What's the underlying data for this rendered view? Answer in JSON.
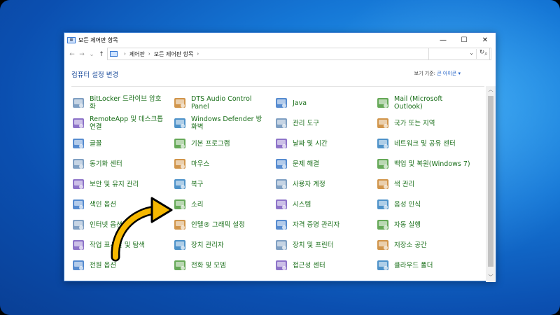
{
  "window": {
    "title": "모든 제어판 항목"
  },
  "address": {
    "crumbs": [
      "제어판",
      "모든 제어판 항목"
    ]
  },
  "header": {
    "title": "컴퓨터 설정 변경",
    "viewby_label": "보기 기준:",
    "viewby_value": "큰 아이콘"
  },
  "colors": {
    "link": "#1a6f1a",
    "heading": "#1e4e9c",
    "desktop": "#1577d6"
  },
  "items": [
    [
      "BitLocker 드라이브 암호화",
      "DTS Audio Control Panel",
      "Java",
      "Mail (Microsoft Outlook)"
    ],
    [
      "RemoteApp 및 데스크톱 연결",
      "Windows Defender 방화벽",
      "관리 도구",
      "국가 또는 지역"
    ],
    [
      "글꼴",
      "기본 프로그램",
      "날짜 및 시간",
      "네트워크 및 공유 센터"
    ],
    [
      "동기화 센터",
      "마우스",
      "문제 해결",
      "백업 및 복원(Windows 7)"
    ],
    [
      "보안 및 유지 관리",
      "복구",
      "사용자 계정",
      "색 관리"
    ],
    [
      "색인 옵션",
      "소리",
      "시스템",
      "음성 인식"
    ],
    [
      "인터넷 옵션",
      "인텔® 그래픽 설정",
      "자격 증명 관리자",
      "자동 실행"
    ],
    [
      "작업 표시줄 및 탐색",
      "장치 관리자",
      "장치 및 프린터",
      "저장소 공간"
    ],
    [
      "전원 옵션",
      "전화 및 모뎀",
      "접근성 센터",
      "클라우드 폴더"
    ]
  ],
  "icons": [
    [
      "bitlocker-icon",
      "dts-audio-icon",
      "java-icon",
      "mail-icon"
    ],
    [
      "remoteapp-icon",
      "firewall-icon",
      "admin-tools-icon",
      "region-icon"
    ],
    [
      "fonts-icon",
      "default-programs-icon",
      "date-time-icon",
      "network-icon"
    ],
    [
      "sync-center-icon",
      "mouse-icon",
      "troubleshoot-icon",
      "backup-icon"
    ],
    [
      "security-flag-icon",
      "recovery-icon",
      "user-accounts-icon",
      "color-management-icon"
    ],
    [
      "indexing-icon",
      "sound-icon",
      "system-icon",
      "speech-icon"
    ],
    [
      "internet-options-icon",
      "intel-graphics-icon",
      "credential-icon",
      "autoplay-icon"
    ],
    [
      "taskbar-icon",
      "device-manager-icon",
      "devices-printers-icon",
      "storage-spaces-icon"
    ],
    [
      "power-icon",
      "phone-modem-icon",
      "ease-of-access-icon",
      "cloud-folder-icon"
    ]
  ]
}
